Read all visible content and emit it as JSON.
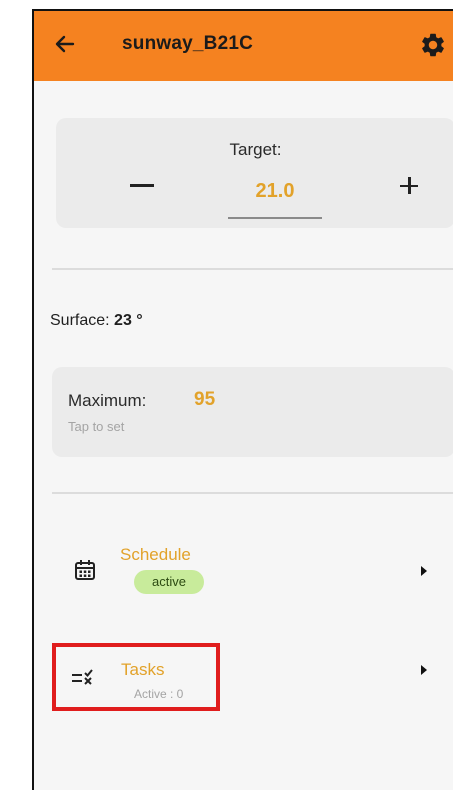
{
  "header": {
    "title": "sunway_B21C",
    "back_icon": "arrow-left-icon",
    "settings_icon": "gear-icon",
    "background_color": "#f58220"
  },
  "target": {
    "label": "Target:",
    "value": "21.0",
    "decrement_icon": "minus-icon",
    "increment_icon": "plus-icon"
  },
  "surface": {
    "label": "Surface:",
    "value": "23 °"
  },
  "maximum": {
    "label": "Maximum:",
    "value": "95",
    "hint": "Tap to set"
  },
  "schedule": {
    "title": "Schedule",
    "status": "active",
    "icon": "calendar-icon"
  },
  "tasks": {
    "title": "Tasks",
    "subtitle": "Active : 0",
    "icon": "tasks-checklist-icon",
    "highlighted": true
  },
  "colors": {
    "accent": "#e2a22a",
    "badge_bg": "#c8eb9b",
    "highlight": "#e01d1d"
  }
}
